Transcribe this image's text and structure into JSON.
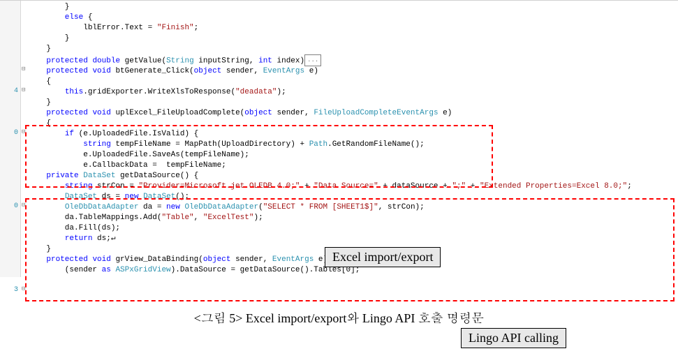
{
  "gutter": {
    "n1": "4",
    "n2": "0",
    "n3": "0",
    "n4": "3"
  },
  "code": {
    "l01": "        }",
    "l02_kw": "        else",
    "l02_rest": " {",
    "l03_a": "            lblError.Text = ",
    "l03_str": "\"Finish\"",
    "l03_b": ";",
    "l04": "        }",
    "l05": "    }",
    "l06": "",
    "l07_a": "    ",
    "l07_kw1": "protected",
    "l07_sp1": " ",
    "l07_kw2": "double",
    "l07_b": " getValue(",
    "l07_type1": "String",
    "l07_c": " inputString, ",
    "l07_kw3": "int",
    "l07_d": " index)",
    "l07_collapse": "...",
    "l08": "",
    "l09_a": "    ",
    "l09_kw1": "protected",
    "l09_sp1": " ",
    "l09_kw2": "void",
    "l09_b": " btGenerate_Click(",
    "l09_kw3": "object",
    "l09_c": " sender, ",
    "l09_type1": "EventArgs",
    "l09_d": " e)",
    "l10": "    {",
    "l11_a": "        ",
    "l11_kw1": "this",
    "l11_b": ".gridExporter.WriteXlsToResponse(",
    "l11_str": "\"deadata\"",
    "l11_c": ");",
    "l12": "    }",
    "l13_a": "    ",
    "l13_kw1": "protected",
    "l13_sp1": " ",
    "l13_kw2": "void",
    "l13_b": " uplExcel_FileUploadComplete(",
    "l13_kw3": "object",
    "l13_c": " sender, ",
    "l13_type1": "FileUploadCompleteEventArgs",
    "l13_d": " e)",
    "l14": "    {",
    "l15_a": "        ",
    "l15_kw1": "if",
    "l15_b": " (e.UploadedFile.IsValid) {",
    "l16_a": "            ",
    "l16_kw1": "string",
    "l16_b": " tempFileName = MapPath(UploadDirectory) + ",
    "l16_type1": "Path",
    "l16_c": ".GetRandomFileName();",
    "l17": "            e.UploadedFile.SaveAs(tempFileName);",
    "l18": "            e.CallbackData =  tempFileName;",
    "l19": "",
    "l20_a": "    ",
    "l20_kw1": "private",
    "l20_sp1": " ",
    "l20_type1": "DataSet",
    "l20_b": " getDataSource() {",
    "l21_a": "        ",
    "l21_kw1": "string",
    "l21_b": " strCon = ",
    "l21_str1": "\"Provider=Microsoft.jet.OLEDB.4.0;\"",
    "l21_c": " + ",
    "l21_str2": "\"Data Source=\"",
    "l21_d": " + dataSource + ",
    "l21_str3": "\";\"",
    "l21_e": " + ",
    "l21_str4": "\"Extended Properties=Excel 8.0;\"",
    "l21_f": ";",
    "l22_a": "        ",
    "l22_type1": "DataSet",
    "l22_b": " ds = ",
    "l22_kw1": "new",
    "l22_sp1": " ",
    "l22_type2": "DataSet",
    "l22_c": "();",
    "l23_a": "        ",
    "l23_type1": "OleDbDataAdapter",
    "l23_b": " da = ",
    "l23_kw1": "new",
    "l23_sp1": " ",
    "l23_type2": "OleDbDataAdapter",
    "l23_c": "(",
    "l23_str1": "\"SELECT * FROM [SHEET1$]\"",
    "l23_d": ", strCon);",
    "l24_a": "        da.TableMappings.Add(",
    "l24_str1": "\"Table\"",
    "l24_b": ", ",
    "l24_str2": "\"ExcelTest\"",
    "l24_c": ");",
    "l25": "        da.Fill(ds);",
    "l26_a": "        ",
    "l26_kw1": "return",
    "l26_b": " ds;↵",
    "l27": "    }",
    "l28_a": "    ",
    "l28_kw1": "protected",
    "l28_sp1": " ",
    "l28_kw2": "void",
    "l28_b": " grView_DataBinding(",
    "l28_kw3": "object",
    "l28_c": " sender, ",
    "l28_type1": "EventArgs",
    "l28_d": " e) {",
    "l29_a": "        (sender ",
    "l29_kw1": "as",
    "l29_sp1": " ",
    "l29_type1": "ASPxGridView",
    "l29_b": ").DataSource = getDataSource().Tables[0];"
  },
  "labels": {
    "excel": "Excel import/export",
    "lingo": "Lingo API calling"
  },
  "caption": "<그림 5> Excel import/export와 Lingo API 호출 명령문"
}
